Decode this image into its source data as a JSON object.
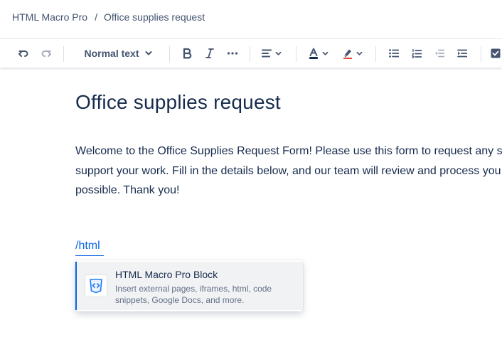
{
  "breadcrumb": {
    "app": "HTML Macro Pro",
    "separator": "/",
    "page": "Office supplies request"
  },
  "toolbar": {
    "text_style": "Normal text",
    "icons": {
      "undo": "undo-icon",
      "redo": "redo-icon",
      "bold": "bold-icon",
      "italic": "italic-icon",
      "more": "more-formatting-icon",
      "align": "align-left-icon",
      "text_color": "text-color-icon",
      "highlight": "highlight-icon",
      "bullet_list": "bullet-list-icon",
      "numbered_list": "numbered-list-icon",
      "outdent": "outdent-icon",
      "indent": "indent-icon",
      "task": "task-checkbox-icon"
    },
    "colors": {
      "text_color_bar": "#172b4d",
      "highlight_bar": "#e2483d"
    }
  },
  "page": {
    "title": "Office supplies request",
    "intro_lines": [
      "Welcome to the Office Supplies Request Form! Please use this form to request any s",
      "support your work. Fill in the details below, and our team will review and process you",
      "possible. Thank you!"
    ]
  },
  "editor": {
    "slash_command": "/html"
  },
  "menu": {
    "items": [
      {
        "title": "HTML Macro Pro Block",
        "description": "Insert external pages, iframes, html, code snippets, Google Docs, and more.",
        "icon": "html-code-icon"
      }
    ]
  },
  "colors": {
    "accent": "#0c66e4",
    "text": "#172b4d",
    "subtle": "#44546f"
  }
}
